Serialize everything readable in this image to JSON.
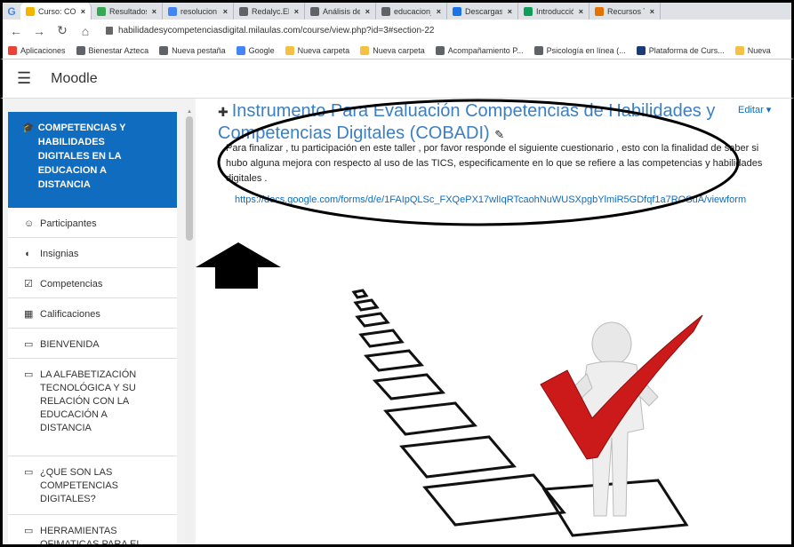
{
  "browser": {
    "tabs": [
      {
        "label": "Curso: COM",
        "color": "#f4b400",
        "active": true
      },
      {
        "label": "Resultados",
        "color": "#34a853",
        "active": false
      },
      {
        "label": "resolucion d",
        "color": "#4285f4",
        "active": false
      },
      {
        "label": "Redalyc.El p",
        "color": "#5f6368",
        "active": false
      },
      {
        "label": "Análisis del",
        "color": "#5f6368",
        "active": false
      },
      {
        "label": "educacion_",
        "color": "#5f6368",
        "active": false
      },
      {
        "label": "Descargas",
        "color": "#1a73e8",
        "active": false
      },
      {
        "label": "Introducció",
        "color": "#0f9d58",
        "active": false
      },
      {
        "label": "Recursos Te",
        "color": "#e37400",
        "active": false
      }
    ],
    "url": "habilidadesycompetenciasdigital.milaulas.com/course/view.php?id=3#section-22",
    "bookmarks": [
      {
        "label": "Aplicaciones",
        "color": "#ea4335"
      },
      {
        "label": "Bienestar Azteca",
        "color": "#5f6368"
      },
      {
        "label": "Nueva pestaña",
        "color": "#5f6368"
      },
      {
        "label": "Google",
        "color": "#4285f4"
      },
      {
        "label": "Nueva carpeta",
        "color": "#f6c042"
      },
      {
        "label": "Nueva carpeta",
        "color": "#f6c042"
      },
      {
        "label": "Acompañamiento P...",
        "color": "#5f6368"
      },
      {
        "label": "Psicología en línea (...",
        "color": "#5f6368"
      },
      {
        "label": "Plataforma de Curs...",
        "color": "#1a3a7a"
      },
      {
        "label": "Nueva",
        "color": "#f6c042"
      }
    ]
  },
  "header": {
    "brand": "Moodle"
  },
  "drawer": {
    "course": "COMPETENCIAS Y\nHABILIDADES\nDIGITALES EN LA\nEDUCACION A\nDISTANCIA",
    "items": [
      {
        "icon": "users-icon",
        "glyph": "☺",
        "label": "Participantes"
      },
      {
        "icon": "shield-icon",
        "glyph": "◖",
        "label": "Insignias"
      },
      {
        "icon": "checkbox-icon",
        "glyph": "☑",
        "label": "Competencias"
      },
      {
        "icon": "table-icon",
        "glyph": "▦",
        "label": "Calificaciones"
      },
      {
        "icon": "folder-icon",
        "glyph": "▭",
        "label": "BIENVENIDA"
      },
      {
        "icon": "folder-icon",
        "glyph": "▭",
        "label": "LA ALFABETIZACIÓN\nTECNOLÓGICA Y SU\nRELACIÓN CON LA\nEDUCACIÓN A\nDISTANCIA"
      },
      {
        "icon": "folder-icon",
        "glyph": "▭",
        "label": "¿QUE SON LAS\nCOMPETENCIAS\nDIGITALES?"
      },
      {
        "icon": "folder-icon",
        "glyph": "▭",
        "label": "HERRAMIENTAS\nOFIMATICAS PARA EL"
      }
    ]
  },
  "main": {
    "title_top": "Instrumento Para Evaluación Competencias de Habilidades y",
    "title_bottom": "Competencias Digitales (COBADI)",
    "edit": "Editar",
    "description": "Para finalizar , tu participación en este taller , por favor responde el siguiente cuestionario , esto con la finalidad de saber si hubo alguna mejora con respecto al uso de las TICS, especificamente en lo que se refiere a las competencias y habilidades digitales .",
    "form_link": "https://docs.google.com/forms/d/e/1FAIpQLSc_FXQePX17wlIqRTcaohNuWUSXpgbYlmiR5GDfqf1a7ROSuA/viewform"
  },
  "colors": {
    "brand_blue": "#0f6cbf",
    "check_red": "#cc1a1a"
  }
}
